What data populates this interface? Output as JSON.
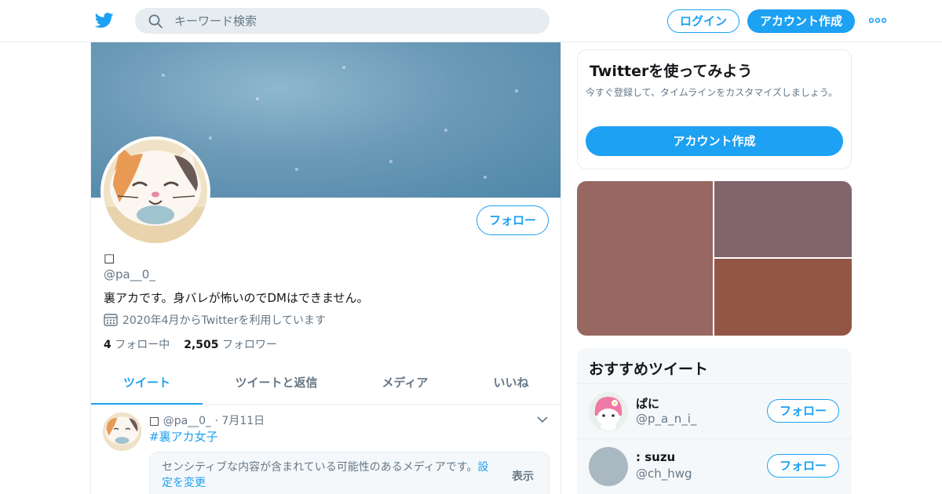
{
  "header": {
    "logo_icon": "twitter-bird-icon",
    "search_placeholder": "キーワード検索",
    "login_label": "ログイン",
    "signup_label": "アカウント作成",
    "more_icon": "more-dots-icon"
  },
  "profile": {
    "display_name": "□",
    "screen_name": "@pa__0_",
    "follow_label": "フォロー",
    "bio": "裏アカです。身バレが怖いのでDMはできません。",
    "joined": "2020年4月からTwitterを利用しています",
    "following_count": "4",
    "following_label": "フォロー中",
    "followers_count": "2,505",
    "followers_label": "フォロワー"
  },
  "tabs": [
    {
      "label": "ツイート",
      "active": true
    },
    {
      "label": "ツイートと返信",
      "active": false
    },
    {
      "label": "メディア",
      "active": false
    },
    {
      "label": "いいね",
      "active": false
    }
  ],
  "tweet": {
    "display_name": "□",
    "screen_name": "@pa__0_",
    "separator": "·",
    "date": "7月11日",
    "hashtag": "#裏アカ女子",
    "sensitive_text": "センシティブな内容が含まれている可能性のあるメディアです。",
    "settings_link": "設定を変更",
    "show_label": "表示"
  },
  "signup_card": {
    "title": "Twitterを使ってみよう",
    "description": "今すぐ登録して、タイムラインをカスタマイズしましょう。",
    "button_label": "アカウント作成"
  },
  "media_colors": [
    "#976861",
    "#81656a",
    "#925644"
  ],
  "recommendations": {
    "title": "おすすめツイート",
    "users": [
      {
        "name": "ぱに",
        "screen_name": "@p_a_n_i_",
        "follow_label": "フォロー"
      },
      {
        "name": ": suzu",
        "screen_name": "@ch_hwg",
        "follow_label": "フォロー"
      }
    ]
  },
  "colors": {
    "accent": "#1da1f2",
    "secondary_text": "#657786",
    "border": "#e6ecf0"
  }
}
